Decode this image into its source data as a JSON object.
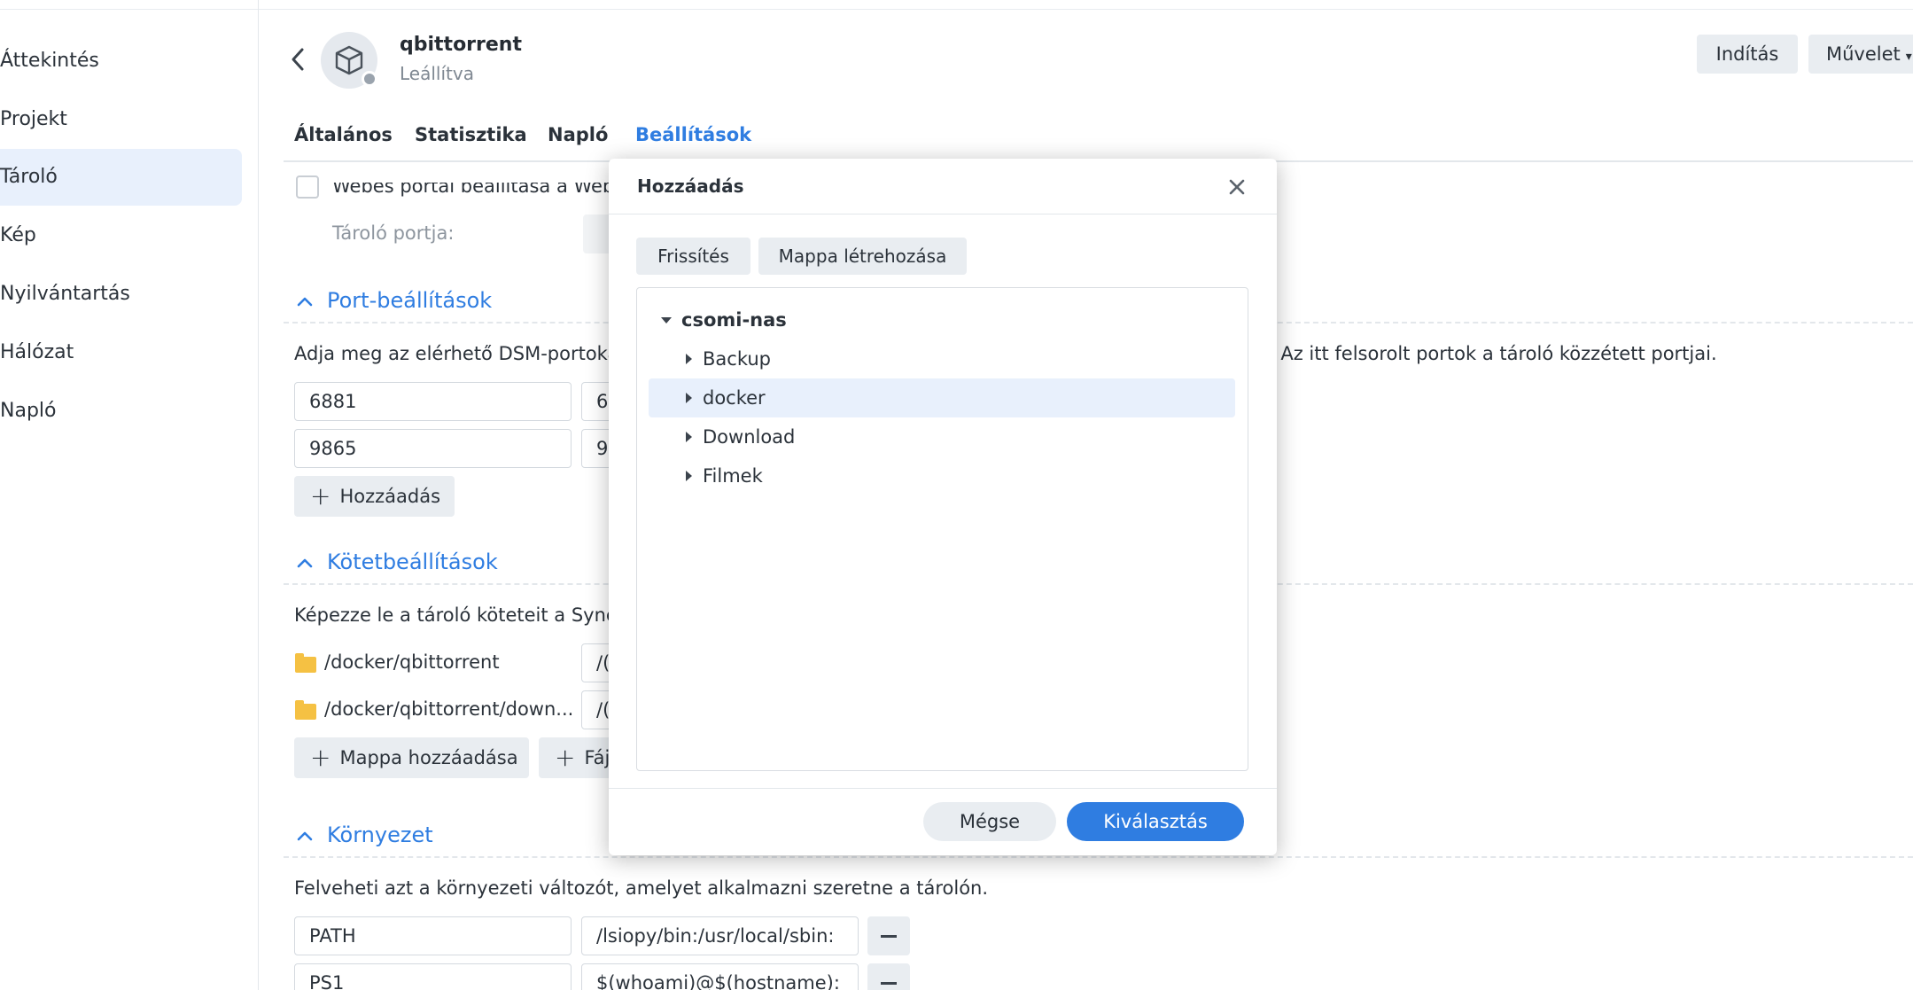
{
  "sidebar": {
    "items": [
      {
        "label": "Áttekintés",
        "active": false
      },
      {
        "label": "Projekt",
        "active": false
      },
      {
        "label": "Tároló",
        "active": true
      },
      {
        "label": "Kép",
        "active": false
      },
      {
        "label": "Nyilvántartás",
        "active": false
      },
      {
        "label": "Hálózat",
        "active": false
      },
      {
        "label": "Napló",
        "active": false
      }
    ]
  },
  "header": {
    "container_name": "qbittorrent",
    "container_status": "Leállítva",
    "start_label": "Indítás",
    "action_label": "Művelet"
  },
  "tabs": [
    {
      "label": "Általános",
      "active": false
    },
    {
      "label": "Statisztika",
      "active": false
    },
    {
      "label": "Napló",
      "active": false
    },
    {
      "label": "Beállítások",
      "active": true
    }
  ],
  "web_portal": {
    "checkbox_label": "Webes portál beállítása a Web",
    "port_label": "Tároló portja:"
  },
  "port_settings": {
    "title": "Port-beállítások",
    "description_left": "Adja meg az elérhető DSM-portoka",
    "description_right": ". Az itt felsorolt portok a tároló közzétett portjai.",
    "rows": [
      {
        "local": "6881",
        "container": "6"
      },
      {
        "local": "9865",
        "container": "9"
      }
    ],
    "add_label": "Hozzáadás"
  },
  "volume_settings": {
    "title": "Kötetbeállítások",
    "description": "Képezze le a tároló köteteit a Sync",
    "rows": [
      {
        "path": "/docker/qbittorrent",
        "mount": "/("
      },
      {
        "path": "/docker/qbittorrent/down...",
        "mount": "/("
      }
    ],
    "add_folder_label": "Mappa hozzáadása",
    "add_file_label": "Fáj"
  },
  "environment": {
    "title": "Környezet",
    "description": "Felveheti azt a környezeti változót, amelyet alkalmazni szeretne a tárolón.",
    "rows": [
      {
        "name": "PATH",
        "value": "/lsiopy/bin:/usr/local/sbin:"
      },
      {
        "name": "PS1",
        "value": "$(whoami)@$(hostname):"
      }
    ]
  },
  "dialog": {
    "title": "Hozzáadás",
    "refresh_label": "Frissítés",
    "create_folder_label": "Mappa létrehozása",
    "tree": {
      "root": "csomi-nas",
      "children": [
        {
          "label": "Backup",
          "selected": false
        },
        {
          "label": "docker",
          "selected": true
        },
        {
          "label": "Download",
          "selected": false
        },
        {
          "label": "Filmek",
          "selected": false
        }
      ]
    },
    "cancel_label": "Mégse",
    "select_label": "Kiválasztás"
  },
  "colors": {
    "accent": "#2f7de1",
    "selected_bg": "#e8f0fc",
    "button_bg": "#e9edf1",
    "folder": "#f5c143"
  }
}
